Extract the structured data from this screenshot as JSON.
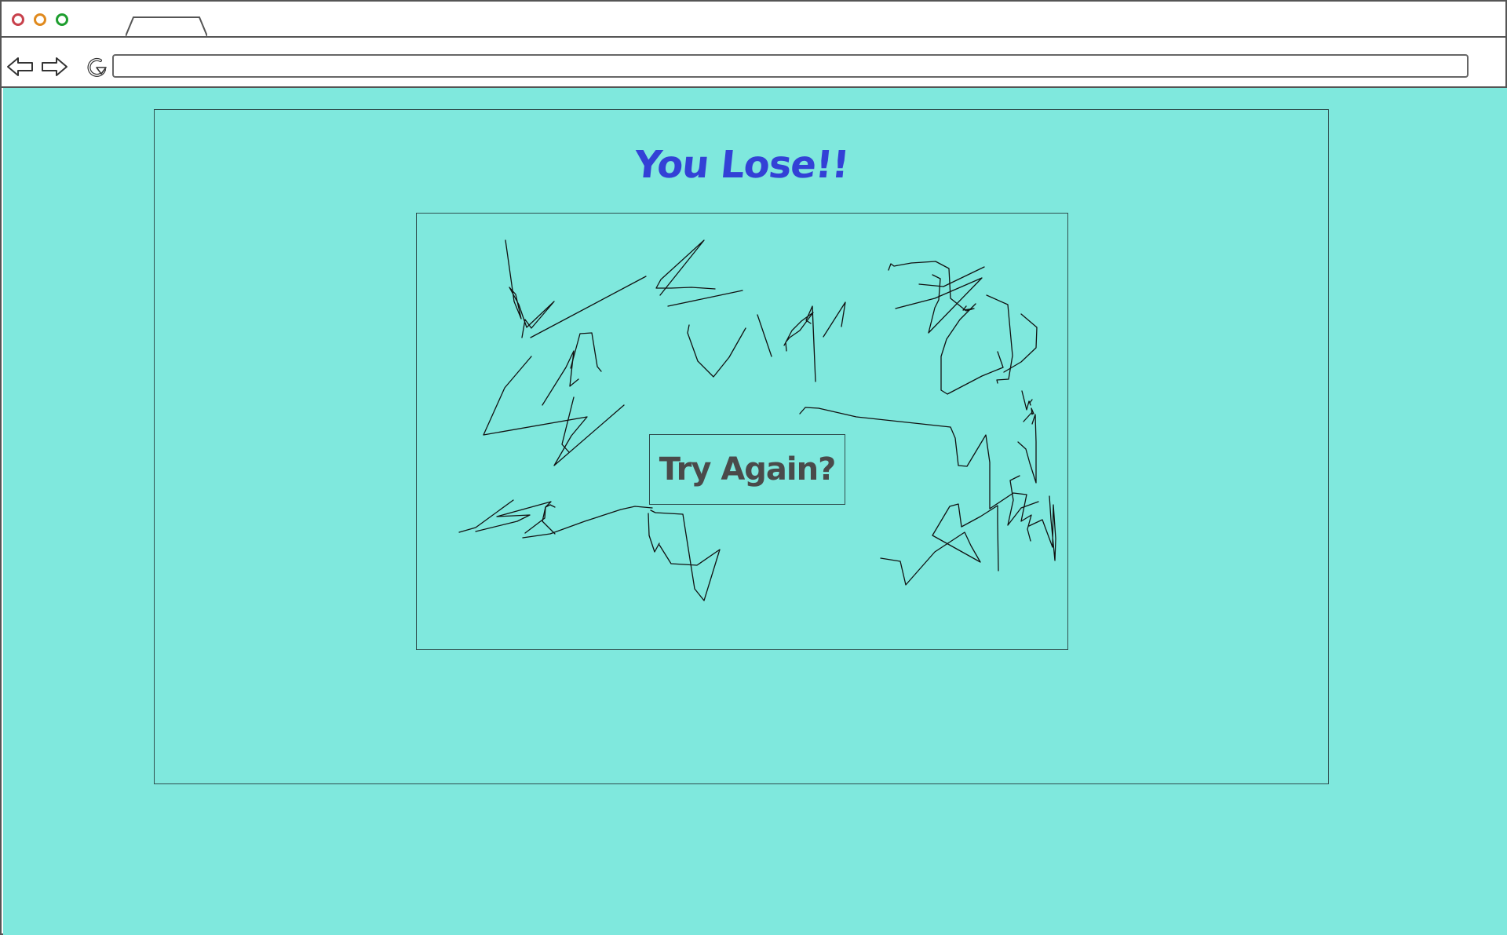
{
  "browser": {
    "address_value": "",
    "icons": {
      "back": "back-arrow-icon",
      "forward": "forward-arrow-icon",
      "reload": "reload-icon"
    },
    "window_controls": {
      "close_color": "#c8414c",
      "minimize_color": "#e08a1e",
      "maximize_color": "#1e9e2f"
    }
  },
  "page": {
    "background_color": "#7fe8dd",
    "title": "You Lose!!",
    "title_color": "#3341d6",
    "button_label": "Try Again?",
    "button_text_color": "#4a4a4a"
  }
}
